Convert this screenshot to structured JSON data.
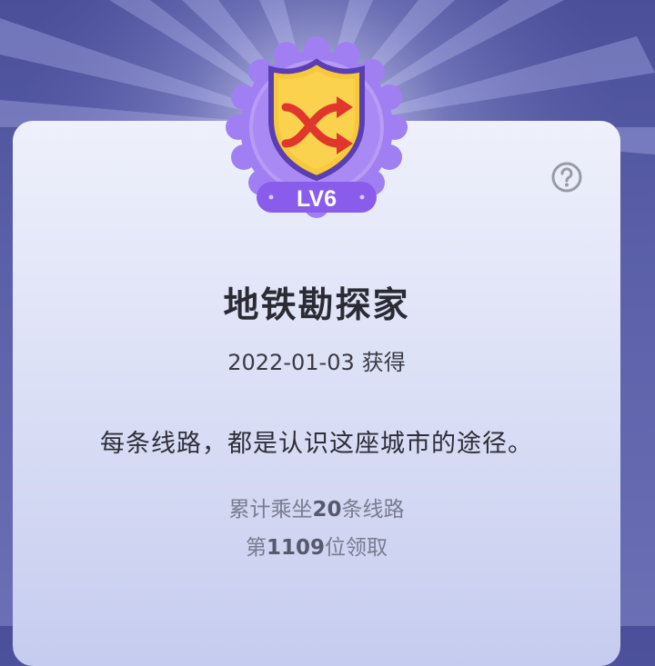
{
  "badge": {
    "level": "LV6",
    "icon": "shuffle-icon",
    "colors": {
      "ribbon": "#9b6cf0",
      "shield": "#f5c93a",
      "arrows": "#e0362b"
    }
  },
  "achievement": {
    "title": "地铁勘探家",
    "date": "2022-01-03",
    "date_suffix": "获得",
    "slogan": "每条线路，都是认识这座城市的途径。"
  },
  "stats": {
    "line1_prefix": "累计乘坐",
    "line1_value": "20",
    "line1_suffix": "条线路",
    "line2_prefix": "第",
    "line2_value": "1109",
    "line2_suffix": "位领取"
  },
  "help_icon": "question-circle-icon"
}
